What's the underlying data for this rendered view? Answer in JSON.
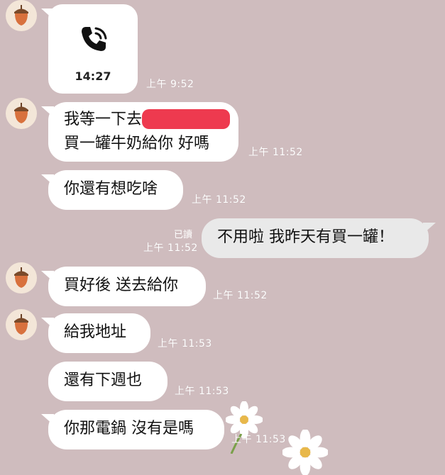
{
  "call": {
    "duration": "14:27",
    "time": "上午 9:52"
  },
  "messages": [
    {
      "lines": [
        "我等一下去",
        "買一罐牛奶給你 好嗎"
      ],
      "time": "上午 11:52"
    },
    {
      "lines": [
        "你還有想吃啥"
      ],
      "time": "上午 11:52"
    },
    {
      "lines": [
        "買好後 送去給你"
      ],
      "time": "上午 11:52"
    },
    {
      "lines": [
        "給我地址"
      ],
      "time": "上午 11:53"
    },
    {
      "lines": [
        "還有下週也"
      ],
      "time": "上午 11:53"
    },
    {
      "lines": [
        "你那電鍋 沒有是嗎"
      ],
      "time": "上午 11:53"
    }
  ],
  "outgoing": {
    "text": "不用啦 我昨天有買一罐！",
    "read_label": "已讀",
    "time": "上午 11:52"
  },
  "colors": {
    "background": "#cfbcbe",
    "bubble_in": "#ffffff",
    "bubble_out": "#e9e9e9",
    "redaction": "#ee3a4f",
    "acorn": "#d8713d"
  },
  "icons": {
    "avatar": "acorn-icon",
    "call": "phone-call-icon",
    "decoration": "daisy-flower-icon"
  }
}
